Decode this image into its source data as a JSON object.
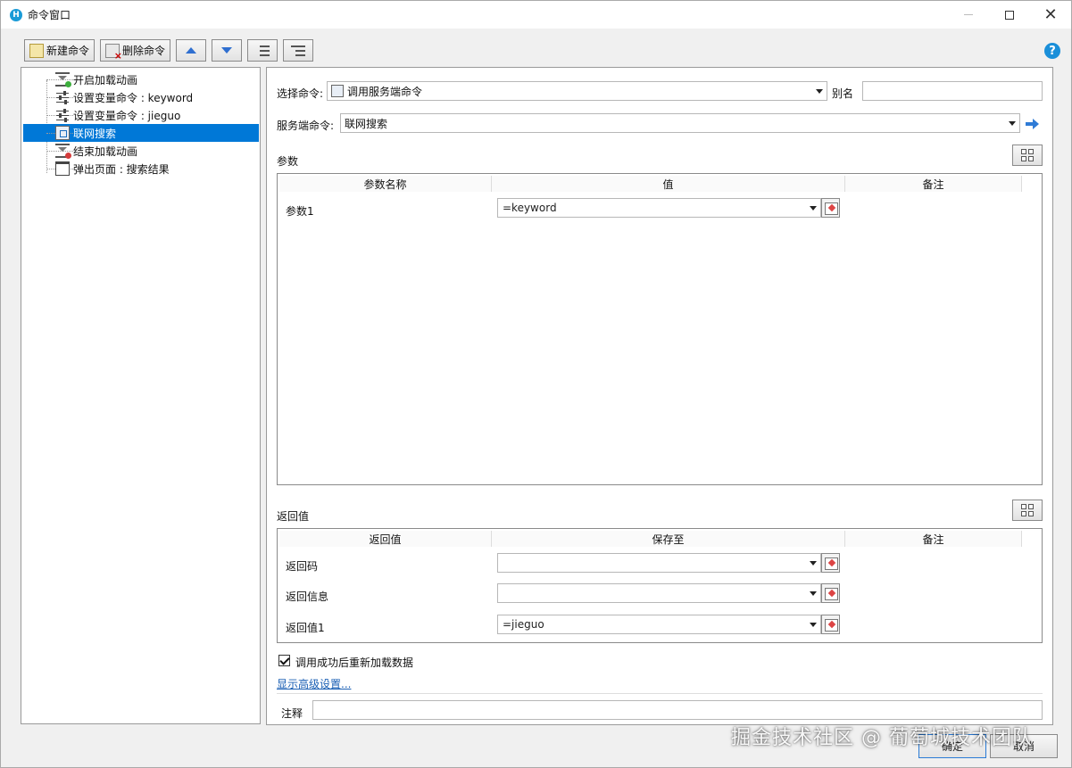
{
  "window": {
    "title": "命令窗口"
  },
  "toolbar": {
    "new_label": "新建命令",
    "delete_label": "删除命令"
  },
  "tree": {
    "items": [
      {
        "label": "开启加载动画",
        "icon": "hourglass-start-icon"
      },
      {
        "label": "设置变量命令 : keyword",
        "icon": "sliders-icon"
      },
      {
        "label": "设置变量命令 : jieguo",
        "icon": "sliders-icon"
      },
      {
        "label": "联网搜索",
        "icon": "server-command-icon",
        "selected": true
      },
      {
        "label": "结束加载动画",
        "icon": "hourglass-stop-icon"
      },
      {
        "label": "弹出页面 : 搜索结果",
        "icon": "page-icon"
      }
    ]
  },
  "form": {
    "select_command_label": "选择命令:",
    "select_command_value": "调用服务端命令",
    "alias_label": "别名",
    "alias_value": "",
    "server_command_label": "服务端命令:",
    "server_command_value": "联网搜索",
    "params_title": "参数",
    "params_columns": [
      "参数名称",
      "值",
      "备注"
    ],
    "params_rows": [
      {
        "name": "参数1",
        "value": "=keyword"
      }
    ],
    "returns_title": "返回值",
    "returns_columns": [
      "返回值",
      "保存至",
      "备注"
    ],
    "returns_rows": [
      {
        "name": "返回码",
        "value": ""
      },
      {
        "name": "返回信息",
        "value": ""
      },
      {
        "name": "返回值1",
        "value": "=jieguo"
      }
    ],
    "reload_checkbox_label": "调用成功后重新加载数据",
    "reload_checked": true,
    "advanced_link": "显示高级设置...",
    "comment_label": "注释",
    "comment_value": ""
  },
  "footer": {
    "ok_label": "确定",
    "cancel_label": "取消"
  },
  "watermark": "掘金技术社区 @ 葡萄城技术团队",
  "colors": {
    "selection": "#0078d7",
    "accent": "#2f7bd6",
    "link": "#1a5fb4"
  }
}
